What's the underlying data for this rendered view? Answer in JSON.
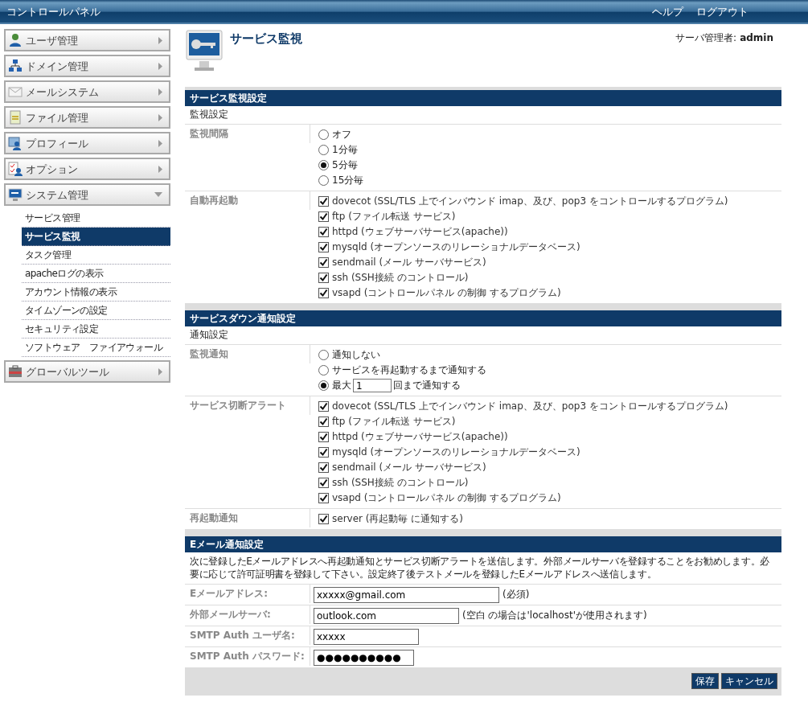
{
  "header": {
    "title": "コントロールパネル",
    "links": [
      "ヘルプ",
      "ログアウト"
    ]
  },
  "sidebar": {
    "items": [
      {
        "label": "ユーザ管理",
        "expanded": false
      },
      {
        "label": "ドメイン管理",
        "expanded": false
      },
      {
        "label": "メールシステム",
        "expanded": false
      },
      {
        "label": "ファイル管理",
        "expanded": false
      },
      {
        "label": "プロフィール",
        "expanded": false
      },
      {
        "label": "オプション",
        "expanded": false
      },
      {
        "label": "システム管理",
        "expanded": true,
        "children": [
          {
            "label": "サービス管理",
            "selected": false
          },
          {
            "label": "サービス監視",
            "selected": true
          },
          {
            "label": "タスク管理",
            "selected": false
          },
          {
            "label": "apacheログの表示",
            "selected": false
          },
          {
            "label": "アカウント情報の表示",
            "selected": false
          },
          {
            "label": "タイムゾーンの設定",
            "selected": false
          },
          {
            "label": "セキュリティ設定",
            "selected": false
          },
          {
            "label": "ソフトウェア　ファイアウォール",
            "selected": false
          }
        ]
      },
      {
        "label": "グローバルツール",
        "expanded": false
      }
    ]
  },
  "page": {
    "title": "サービス監視",
    "user_label": "サーバ管理者:",
    "user": "admin"
  },
  "sections": [
    {
      "title": "サービス監視設定",
      "subtitle": "監視設定",
      "rows": [
        {
          "label": "監視間隔",
          "kind": "radios",
          "options": [
            {
              "label": "オフ",
              "selected": false
            },
            {
              "label": "1分毎",
              "selected": false
            },
            {
              "label": "5分毎",
              "selected": true
            },
            {
              "label": "15分毎",
              "selected": false
            }
          ]
        },
        {
          "label": "自動再起動",
          "kind": "checks",
          "items": [
            {
              "label": "dovecot (SSL/TLS 上でインバウンド imap、及び、pop3 をコントロールするプログラム)",
              "checked": true
            },
            {
              "label": "ftp (ファイル転送 サービス)",
              "checked": true
            },
            {
              "label": "httpd (ウェブサーバサービス(apache))",
              "checked": true
            },
            {
              "label": "mysqld (オープンソースのリレーショナルデータベース)",
              "checked": true
            },
            {
              "label": "sendmail (メール サーバサービス)",
              "checked": true
            },
            {
              "label": "ssh (SSH接続 のコントロール)",
              "checked": true
            },
            {
              "label": "vsapd (コントロールパネル の制御 するプログラム)",
              "checked": true
            }
          ]
        }
      ]
    },
    {
      "title": "サービスダウン通知設定",
      "subtitle": "通知設定",
      "rows": [
        {
          "label": "監視通知",
          "kind": "radios",
          "options": [
            {
              "label": "通知しない",
              "selected": false
            },
            {
              "label": "サービスを再起動するまで通知する",
              "selected": false
            },
            {
              "label": "最大",
              "field": "1",
              "suffix": "回まで通知する",
              "selected": true
            }
          ]
        },
        {
          "label": "サービス切断アラート",
          "kind": "checks",
          "items": [
            {
              "label": "dovecot (SSL/TLS 上でインバウンド imap、及び、pop3 をコントロールするプログラム)",
              "checked": true
            },
            {
              "label": "ftp (ファイル転送 サービス)",
              "checked": true
            },
            {
              "label": "httpd (ウェブサーバサービス(apache))",
              "checked": true
            },
            {
              "label": "mysqld (オープンソースのリレーショナルデータベース)",
              "checked": true
            },
            {
              "label": "sendmail (メール サーバサービス)",
              "checked": true
            },
            {
              "label": "ssh (SSH接続 のコントロール)",
              "checked": true
            },
            {
              "label": "vsapd (コントロールパネル の制御 するプログラム)",
              "checked": true
            }
          ]
        },
        {
          "label": "再起動通知",
          "kind": "checks",
          "items": [
            {
              "label": "server (再起動毎 に通知する)",
              "checked": true
            }
          ]
        }
      ]
    }
  ],
  "email": {
    "title": "Eメール通知設定",
    "description": "次に登録したEメールアドレスへ再起動通知とサービス切断アラートを送信します。外部メールサーバを登録することをお勧めします。必要に応じて許可証明書を登録して下さい。設定終了後テストメールを登録したEメールアドレスへ送信します。",
    "fields": [
      {
        "label": "Eメールアドレス:",
        "value": "xxxxx@gmail.com",
        "note": "(必須)"
      },
      {
        "label": "外部メールサーバ:",
        "value": "outlook.com",
        "note": "(空白 の場合は'localhost'が使用されます)"
      },
      {
        "label": "SMTP Auth ユーザ名:",
        "value": "xxxxx"
      },
      {
        "label": "SMTP Auth パスワード:",
        "value": "●●●●●●●●●●"
      }
    ],
    "buttons": [
      "保存",
      "キャンセル"
    ]
  }
}
